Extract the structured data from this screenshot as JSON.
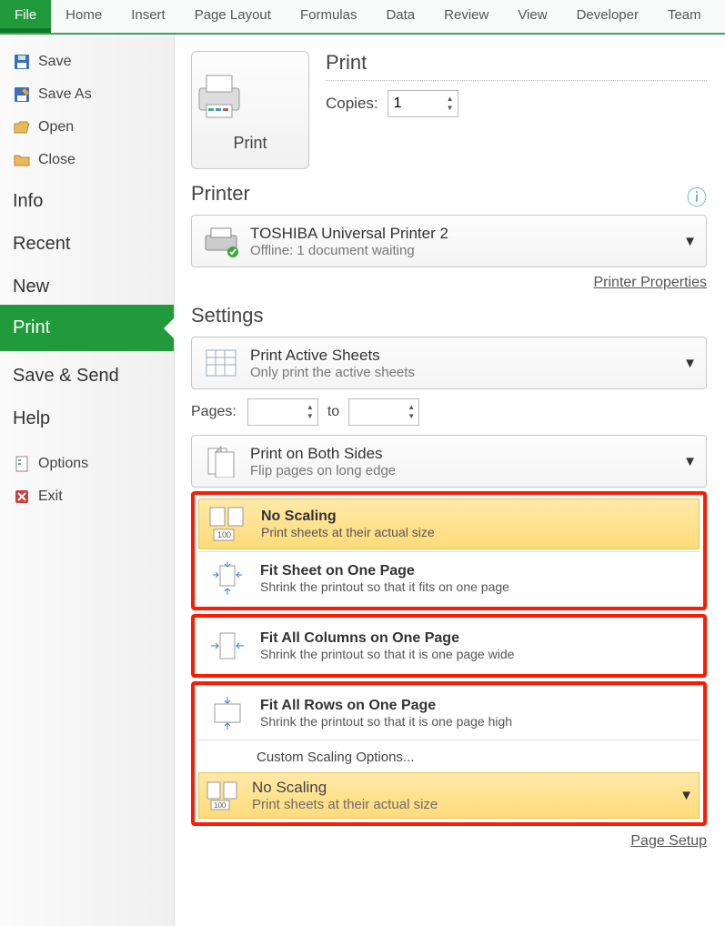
{
  "ribbon": {
    "tabs": [
      "File",
      "Home",
      "Insert",
      "Page Layout",
      "Formulas",
      "Data",
      "Review",
      "View",
      "Developer",
      "Team"
    ],
    "active_index": 0
  },
  "sidebar": {
    "quick": [
      {
        "label": "Save"
      },
      {
        "label": "Save As"
      },
      {
        "label": "Open"
      },
      {
        "label": "Close"
      }
    ],
    "sections": [
      "Info",
      "Recent",
      "New",
      "Print",
      "Save & Send",
      "Help"
    ],
    "active_section_index": 3,
    "footer": [
      {
        "label": "Options"
      },
      {
        "label": "Exit"
      }
    ]
  },
  "print": {
    "big_button_label": "Print",
    "heading": "Print",
    "copies_label": "Copies:",
    "copies_value": "1"
  },
  "printer": {
    "heading": "Printer",
    "name": "TOSHIBA Universal Printer 2",
    "status": "Offline: 1 document waiting",
    "properties_link": "Printer Properties"
  },
  "settings": {
    "heading": "Settings",
    "active_sheets": {
      "title": "Print Active Sheets",
      "desc": "Only print the active sheets"
    },
    "pages_label": "Pages:",
    "pages_from": "",
    "pages_to_label": "to",
    "pages_to": "",
    "duplex": {
      "title": "Print on Both Sides",
      "desc": "Flip pages on long edge"
    },
    "scaling_options": [
      {
        "title": "No Scaling",
        "desc": "Print sheets at their actual size"
      },
      {
        "title": "Fit Sheet on One Page",
        "desc": "Shrink the printout so that it fits on one page"
      },
      {
        "title": "Fit All Columns on One Page",
        "desc": "Shrink the printout so that it is one page wide"
      },
      {
        "title": "Fit All Rows on One Page",
        "desc": "Shrink the printout so that it is one page high"
      }
    ],
    "selected_scaling_index": 0,
    "custom_scaling_label": "Custom Scaling Options...",
    "scaling_current": {
      "title": "No Scaling",
      "desc": "Print sheets at their actual size"
    },
    "page_setup_link": "Page Setup"
  }
}
